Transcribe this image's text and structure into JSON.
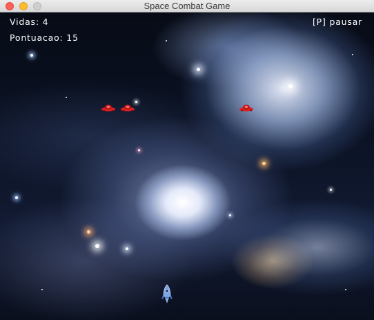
{
  "window": {
    "title": "Space Combat Game"
  },
  "hud": {
    "lives_label": "Vidas: 4",
    "score_label": "Pontuacao: 15",
    "pause_hint": "[P] pausar"
  },
  "colors": {
    "enemy": "#d91f1f",
    "player_body": "#7aa6e6",
    "hud_text": "#ffffff"
  },
  "icons": {
    "enemy": "red-spaceship-icon",
    "player": "rocket-icon"
  },
  "game": {
    "lives": 4,
    "score": 15,
    "enemy_count": 3
  }
}
